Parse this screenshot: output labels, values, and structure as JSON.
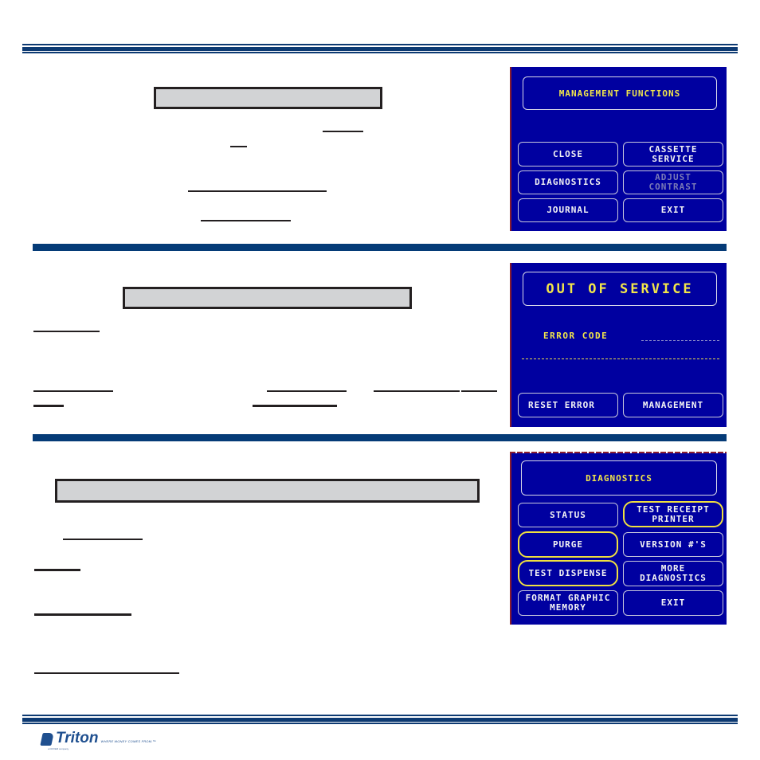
{
  "brand": {
    "logo_text": "Triton",
    "tagline": "WHERE MONEY COMES FROM.™",
    "sub_tagline": "a DOVER company",
    "accent_color": "#0d3a72"
  },
  "screens": {
    "management": {
      "title": "MANAGEMENT FUNCTIONS",
      "buttons": [
        {
          "label": "CLOSE",
          "enabled": true
        },
        {
          "label": "CASSETTE\nSERVICE",
          "enabled": true
        },
        {
          "label": "DIAGNOSTICS",
          "enabled": true
        },
        {
          "label": "ADJUST\nCONTRAST",
          "enabled": false
        },
        {
          "label": "JOURNAL",
          "enabled": true
        },
        {
          "label": "EXIT",
          "enabled": true
        }
      ]
    },
    "out_of_service": {
      "title": "OUT OF SERVICE",
      "error_code_label": "ERROR CODE",
      "buttons": [
        {
          "label": "RESET ERROR"
        },
        {
          "label": "MANAGEMENT"
        }
      ]
    },
    "diagnostics": {
      "title": "DIAGNOSTICS",
      "buttons": [
        {
          "label": "STATUS",
          "highlighted": false
        },
        {
          "label": "TEST RECEIPT\nPRINTER",
          "highlighted": true
        },
        {
          "label": "PURGE",
          "highlighted": true
        },
        {
          "label": "VERSION #'S",
          "highlighted": false
        },
        {
          "label": "TEST DISPENSE",
          "highlighted": true
        },
        {
          "label": "MORE\nDIAGNOSTICS",
          "highlighted": false
        },
        {
          "label": "FORMAT GRAPHIC\nMEMORY",
          "highlighted": false
        },
        {
          "label": "EXIT",
          "highlighted": false
        }
      ]
    }
  }
}
